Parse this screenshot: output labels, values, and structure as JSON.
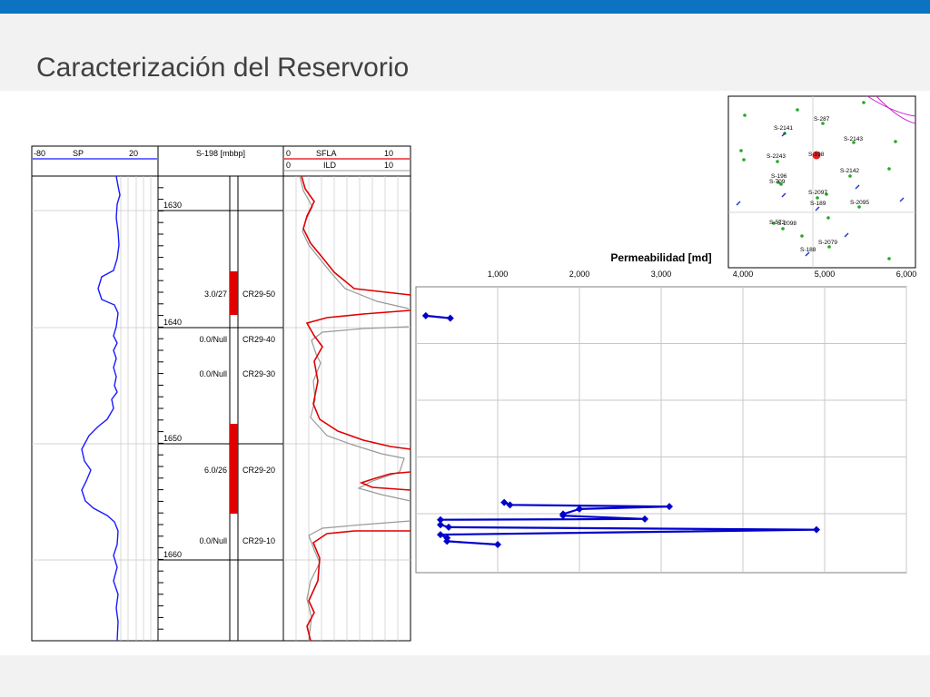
{
  "slide": {
    "title": "Caracterización del Reservorio",
    "accent_color": "#0b73c1",
    "band_color": "#f2f2f2",
    "title_color": "#404040"
  },
  "log_panel": {
    "sp": {
      "min": "-80",
      "name": "SP",
      "max": "20",
      "color": "#1a1aff"
    },
    "depth": {
      "header": "S-198 [mbbp]",
      "ticks": [
        "1630",
        "1640",
        "1650",
        "1660"
      ]
    },
    "zones": [
      {
        "ratio": "3.0/27",
        "name": "CR29-50"
      },
      {
        "ratio": "0.0/Null",
        "name": "CR29-40"
      },
      {
        "ratio": "0.0/Null",
        "name": "CR29-30"
      },
      {
        "ratio": "6.0/26",
        "name": "CR29-20"
      },
      {
        "ratio": "0.0/Null",
        "name": "CR29-10"
      }
    ],
    "perf_color": "#e00000",
    "resistivity": [
      {
        "min": "0",
        "name": "SFLA",
        "max": "10",
        "color": "#e00000"
      },
      {
        "min": "0",
        "name": "ILD",
        "max": "10",
        "color": "#999999"
      }
    ]
  },
  "well_map": {
    "wells": [
      "S-287",
      "S-2141",
      "S-2143",
      "S-2243",
      "S-198",
      "S-2142",
      "S-196",
      "S-709",
      "S-2097",
      "S-189",
      "S-2095",
      "S-2098",
      "S-573",
      "S-2079",
      "S-188"
    ],
    "dot_color": "#22aa22",
    "highlight_color": "#e02020"
  },
  "chart_data": {
    "type": "line",
    "title": "Permeabilidad [md]",
    "xlim": [
      0,
      6000
    ],
    "x_ticks": [
      "1,000",
      "2,000",
      "3,000",
      "4,000",
      "5,000",
      "6,000"
    ],
    "tick_values": [
      1000,
      2000,
      3000,
      4000,
      5000,
      6000
    ],
    "grid": true,
    "color": "#0000cc",
    "series": [
      {
        "points": [
          [
            120,
            1626
          ],
          [
            420,
            1626.3
          ]
        ]
      },
      {
        "points": [
          [
            1080,
            1648.6
          ],
          [
            1150,
            1648.9
          ],
          [
            3100,
            1649.1
          ],
          [
            2000,
            1649.4
          ],
          [
            1800,
            1650
          ],
          [
            1800,
            1650.2
          ],
          [
            2800,
            1650.6
          ],
          [
            300,
            1650.7
          ],
          [
            300,
            1651.3
          ],
          [
            400,
            1651.6
          ],
          [
            4900,
            1651.9
          ],
          [
            300,
            1652.5
          ],
          [
            380,
            1652.9
          ],
          [
            380,
            1653.3
          ],
          [
            1000,
            1653.7
          ]
        ]
      }
    ]
  }
}
